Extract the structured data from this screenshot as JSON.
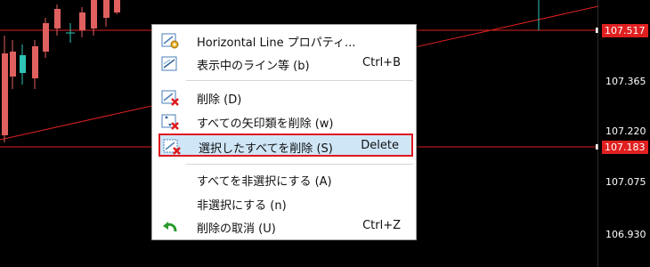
{
  "price_scale": {
    "labels": [
      {
        "text": "107.517",
        "boxed": true
      },
      {
        "text": "107.365",
        "boxed": false
      },
      {
        "text": "107.220",
        "boxed": false
      },
      {
        "text": "107.183",
        "boxed": true
      },
      {
        "text": "107.075",
        "boxed": false
      },
      {
        "text": "106.930",
        "boxed": false
      }
    ]
  },
  "colors": {
    "background": "#000000",
    "horizontal_line": "#e02020",
    "bear_candle": "#e06060",
    "bull_candle": "#2ec4b6",
    "menu_highlight": "#cfe6f7",
    "highlight_border": "#e0171f"
  },
  "context_menu": {
    "items": [
      {
        "label": "Horizontal Line プロパティ...",
        "shortcut": "",
        "icon": "properties-icon"
      },
      {
        "label": "表示中のライン等 (b)",
        "shortcut": "Ctrl+B",
        "icon": "objects-list-icon"
      },
      {
        "label": "削除 (D)",
        "shortcut": "",
        "icon": "delete-icon"
      },
      {
        "label": "すべての矢印類を削除 (w)",
        "shortcut": "",
        "icon": "delete-arrows-icon"
      },
      {
        "label": "選択したすべてを削除 (S)",
        "shortcut": "Delete",
        "icon": "delete-selected-icon"
      },
      {
        "label": "すべてを非選択にする (A)",
        "shortcut": "",
        "icon": ""
      },
      {
        "label": "非選択にする (n)",
        "shortcut": "",
        "icon": ""
      },
      {
        "label": "削除の取消 (U)",
        "shortcut": "Ctrl+Z",
        "icon": "undo-icon"
      }
    ]
  }
}
